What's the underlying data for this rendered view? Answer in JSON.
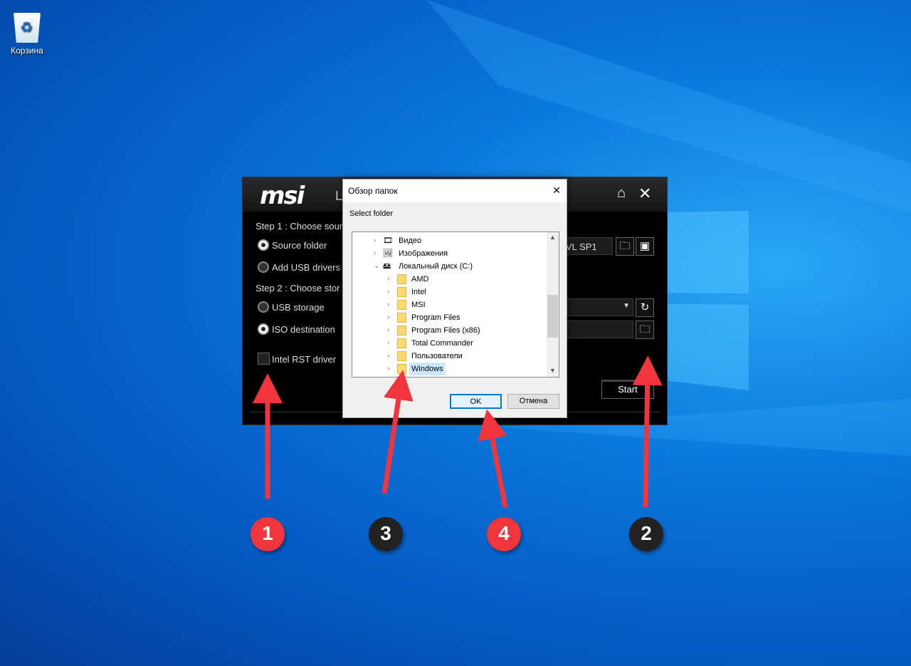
{
  "desktop": {
    "recycle_bin": "Корзина"
  },
  "msi": {
    "logo": "msi",
    "title_partial": "Ц",
    "step1": "Step 1 : Choose sour",
    "source_folder": "Source folder",
    "add_usb": "Add USB drivers",
    "step2": "Step 2 : Choose stor",
    "usb_storage": "USB storage",
    "iso_destination": "ISO destination",
    "intel_rst": "Intel RST driver",
    "source_value": "VL SP1",
    "start": "Start",
    "selected": {
      "source_folder": true,
      "iso_destination": true,
      "intel_rst": false
    }
  },
  "dialog": {
    "title": "Обзор папок",
    "close": "✕",
    "prompt": "Select folder",
    "ok": "OK",
    "cancel": "Отмена",
    "tree": [
      {
        "label": "Видео",
        "level": 1,
        "icon": "video-icon"
      },
      {
        "label": "Изображения",
        "level": 1,
        "icon": "pictures-icon"
      },
      {
        "label": "Локальный диск (C:)",
        "level": 1,
        "icon": "drive-icon",
        "expanded": true
      },
      {
        "label": "AMD",
        "level": 2
      },
      {
        "label": "Intel",
        "level": 2
      },
      {
        "label": "MSI",
        "level": 2
      },
      {
        "label": "Program Files",
        "level": 2
      },
      {
        "label": "Program Files (x86)",
        "level": 2
      },
      {
        "label": "Total Commander",
        "level": 2
      },
      {
        "label": "Пользователи",
        "level": 2
      },
      {
        "label": "Windows",
        "level": 2,
        "selected": true
      }
    ]
  },
  "annotations": [
    {
      "n": "1",
      "color": "#f0363c"
    },
    {
      "n": "2",
      "color": "#222222"
    },
    {
      "n": "3",
      "color": "#222222"
    },
    {
      "n": "4",
      "color": "#f0363c"
    }
  ],
  "colors": {
    "arrow": "#f0363c",
    "accent": "#0078d7"
  }
}
